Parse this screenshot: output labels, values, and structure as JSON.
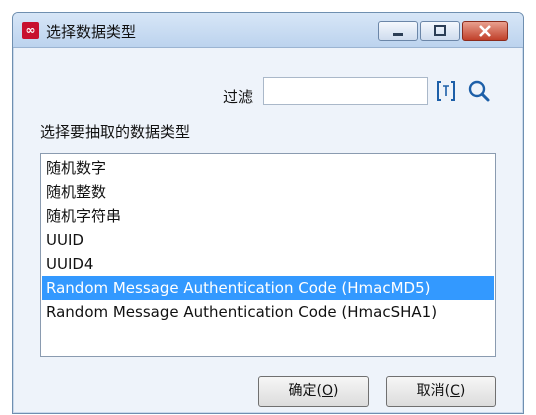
{
  "window": {
    "title": "选择数据类型",
    "app_icon": "app-logo-icon",
    "controls": [
      "minimize-icon",
      "maximize-icon",
      "close-icon"
    ]
  },
  "filter": {
    "label": "过滤",
    "value": "",
    "placeholder": "",
    "regex_icon": "regex-icon",
    "search_icon": "search-icon"
  },
  "list": {
    "label": "选择要抽取的数据类型",
    "items": [
      "随机数字",
      "随机整数",
      "随机字符串",
      "UUID",
      "UUID4",
      "Random Message Authentication Code (HmacMD5)",
      "Random Message Authentication Code (HmacSHA1)"
    ],
    "selected_index": 5
  },
  "buttons": {
    "ok_label": "确定(",
    "ok_key": "O",
    "ok_suffix": ")",
    "cancel_label": "取消(",
    "cancel_key": "C",
    "cancel_suffix": ")"
  },
  "colors": {
    "selection": "#3399ff",
    "accent_icon": "#1d5fa8"
  }
}
